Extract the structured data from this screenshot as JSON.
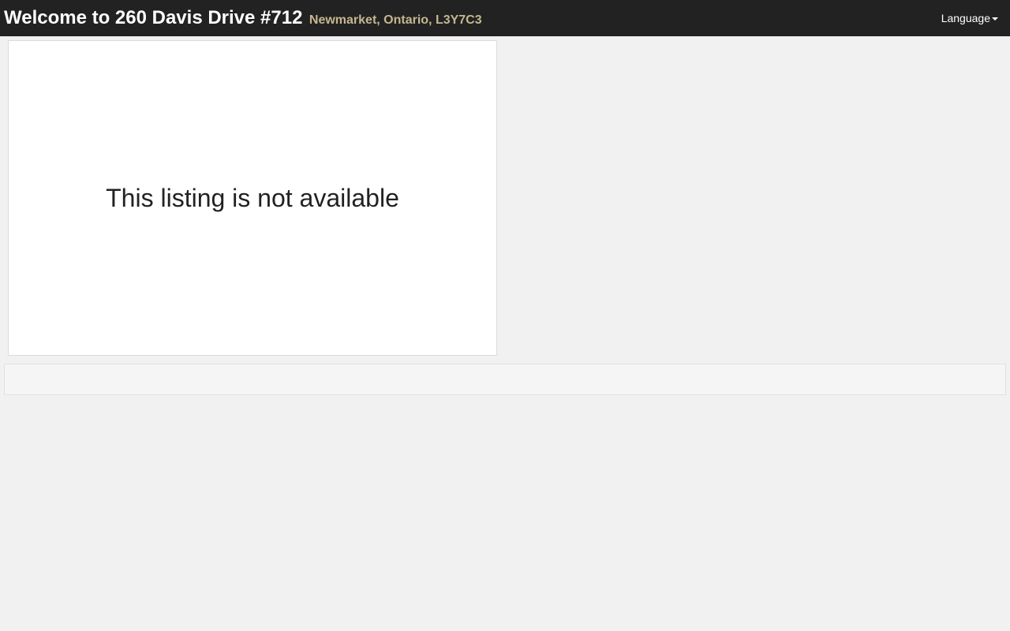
{
  "header": {
    "title": "Welcome to 260 Davis Drive #712",
    "subtitle": "Newmarket, Ontario, L3Y7C3",
    "language_label": "Language",
    "language_icon": "caret-down-icon"
  },
  "listing": {
    "message": "This listing is not available"
  },
  "colors": {
    "header_bg": "#222222",
    "subtitle": "#c5b68f",
    "page_bg": "#f1f1f1"
  }
}
